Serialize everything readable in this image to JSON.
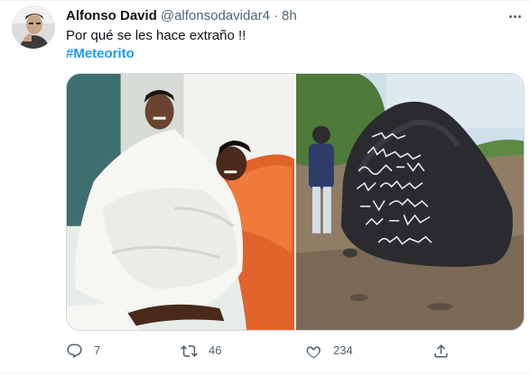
{
  "author": {
    "display_name": "Alfonso David",
    "handle": "@alfonsodavidar4",
    "separator": "·",
    "timestamp": "8h",
    "avatar_icon": "profile-photo"
  },
  "tweet": {
    "text": "Por qué se les hace extraño !!",
    "hashtag": "#Meteorito"
  },
  "media": {
    "photos": [
      {
        "description_icon": "photo-couple-bed"
      },
      {
        "description_icon": "photo-inscribed-rock"
      }
    ]
  },
  "actions": {
    "reply": {
      "icon": "reply-icon",
      "count": "7"
    },
    "retweet": {
      "icon": "retweet-icon",
      "count": "46"
    },
    "like": {
      "icon": "heart-icon",
      "count": "234"
    },
    "share": {
      "icon": "share-icon",
      "count": ""
    }
  },
  "colors": {
    "accent": "#1d9bf0",
    "text_primary": "#0f1419",
    "text_secondary": "#536471",
    "border": "#cfd9de"
  }
}
